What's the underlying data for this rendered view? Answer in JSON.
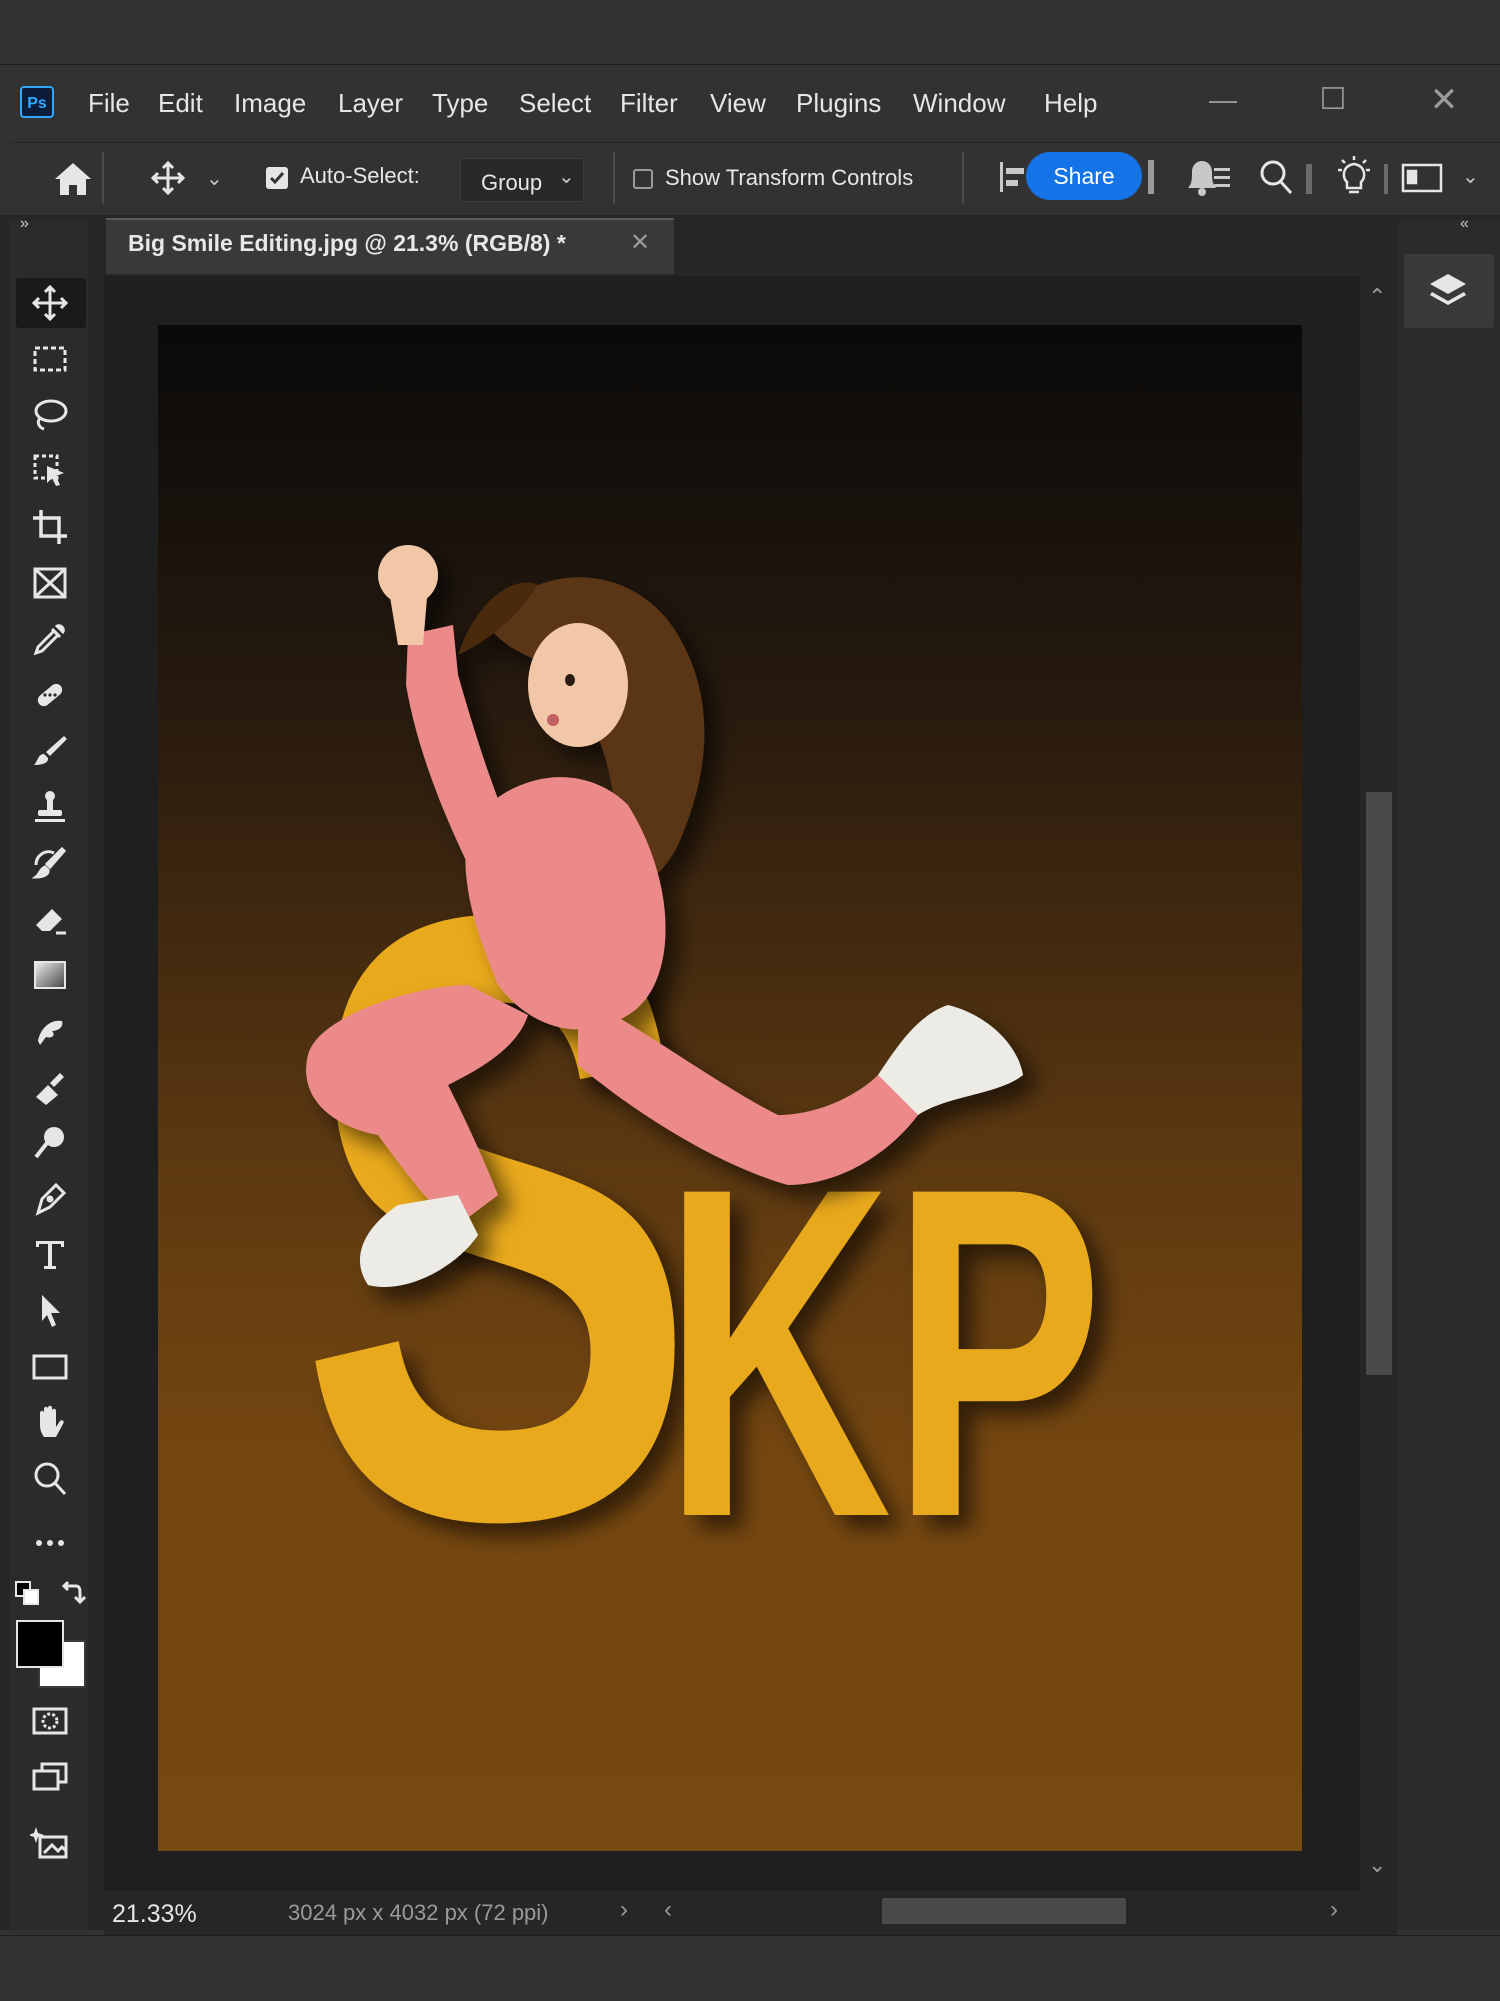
{
  "app": {
    "logo_text": "Ps"
  },
  "menu": [
    "File",
    "Edit",
    "Image",
    "Layer",
    "Type",
    "Select",
    "Filter",
    "View",
    "Plugins",
    "Window",
    "Help"
  ],
  "options_bar": {
    "auto_select_label": "Auto-Select:",
    "auto_select_checked": true,
    "auto_select_value": "Group",
    "transform_label": "Show Transform Controls",
    "transform_checked": false,
    "share_label": "Share"
  },
  "document": {
    "tab_title": "Big Smile Editing.jpg @ 21.3% (RGB/8) *",
    "artwork_text": "SKP"
  },
  "status": {
    "zoom": "21.33%",
    "doc_size": "3024 px x 4032 px (72 ppi)"
  },
  "colors": {
    "share_button": "#1473e6",
    "letter_fill": "#e9a91a",
    "foreground_swatch": "#000000",
    "background_swatch": "#ffffff",
    "suit": "#ec8a8a"
  },
  "tools": [
    "move-tool",
    "rectangular-marquee-tool",
    "lasso-tool",
    "object-selection-tool",
    "crop-tool",
    "frame-tool",
    "eyedropper-tool",
    "spot-healing-tool",
    "brush-tool",
    "clone-stamp-tool",
    "history-brush-tool",
    "eraser-tool",
    "gradient-tool",
    "smudge-tool",
    "dodge-tool",
    "burn-tool",
    "pen-tool",
    "type-tool",
    "path-selection-tool",
    "rectangle-tool",
    "hand-tool",
    "zoom-tool",
    "more-tools",
    "quick-mask",
    "screen-mode",
    "generative-icon"
  ]
}
